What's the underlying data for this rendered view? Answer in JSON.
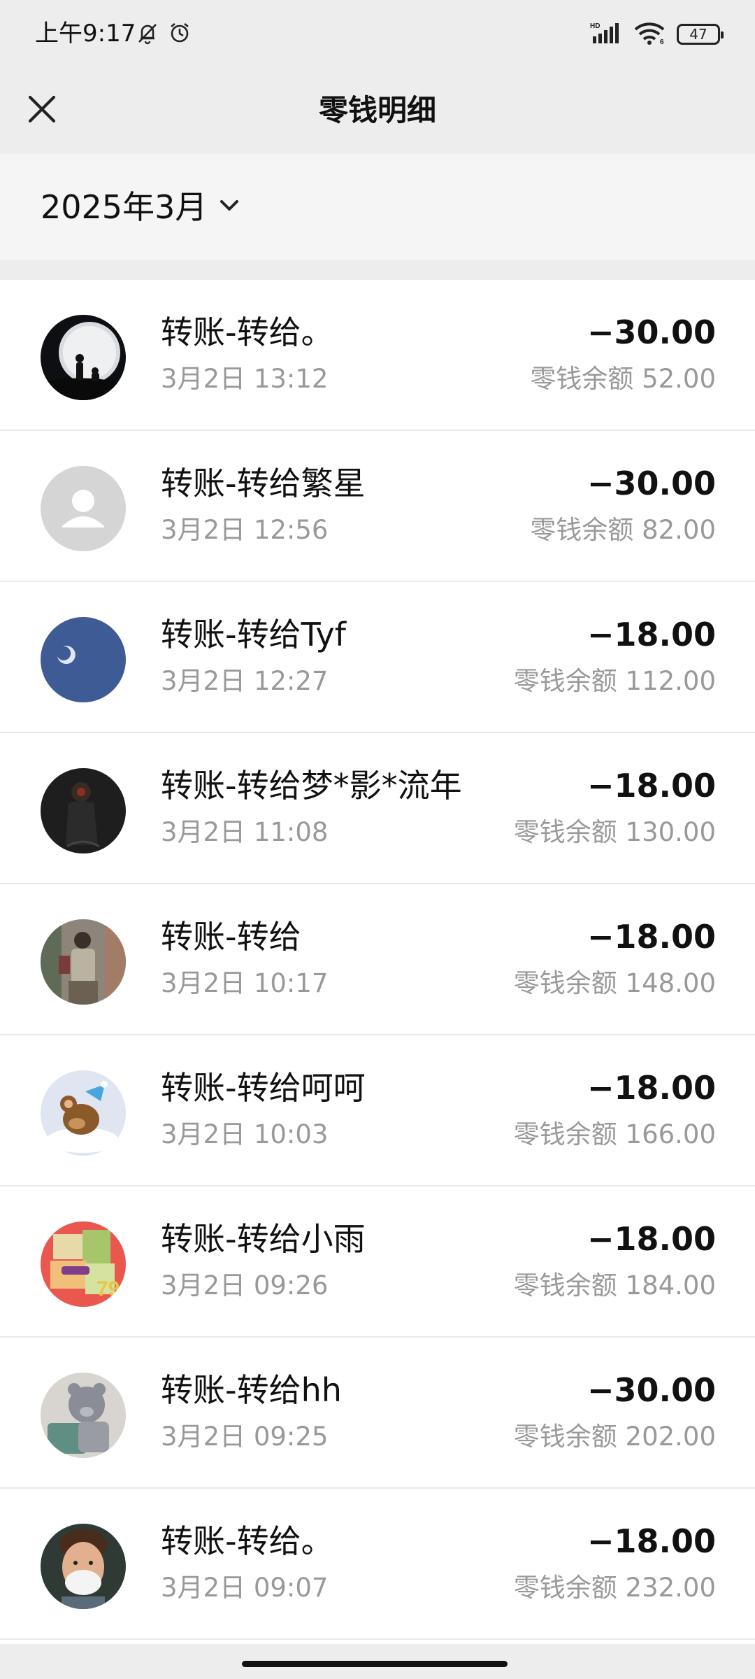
{
  "status": {
    "time": "上午9:17",
    "battery": "47",
    "network_badge": "HD",
    "wifi_badge": "6"
  },
  "header": {
    "title": "零钱明细",
    "close_icon": "close-icon"
  },
  "filter": {
    "month": "2025年3月",
    "dropdown_icon": "chevron-down-icon"
  },
  "transactions": [
    {
      "title": "转账-转给。",
      "time": "3月2日 13:12",
      "amount": "−30.00",
      "balance": "零钱余额 52.00",
      "avatar": "moon-silhouette"
    },
    {
      "title": "转账-转给繁星",
      "time": "3月2日 12:56",
      "amount": "−30.00",
      "balance": "零钱余额 82.00",
      "avatar": "default-user"
    },
    {
      "title": "转账-转给Tyf",
      "time": "3月2日 12:27",
      "amount": "−18.00",
      "balance": "零钱余额 112.00",
      "avatar": "night-sky"
    },
    {
      "title": "转账-转给梦*影*流年",
      "time": "3月2日 11:08",
      "amount": "−18.00",
      "balance": "零钱余额 130.00",
      "avatar": "dark-figure"
    },
    {
      "title": "转账-转给",
      "time": "3月2日 10:17",
      "amount": "−18.00",
      "balance": "零钱余额 148.00",
      "avatar": "mirror-selfie"
    },
    {
      "title": "转账-转给呵呵",
      "time": "3月2日 10:03",
      "amount": "−18.00",
      "balance": "零钱余额 166.00",
      "avatar": "cartoon-mouse"
    },
    {
      "title": "转账-转给小雨",
      "time": "3月2日 09:26",
      "amount": "−18.00",
      "balance": "零钱余额 184.00",
      "avatar": "colorful-map"
    },
    {
      "title": "转账-转给hh",
      "time": "3月2日 09:25",
      "amount": "−30.00",
      "balance": "零钱余额 202.00",
      "avatar": "gray-cat"
    },
    {
      "title": "转账-转给。",
      "time": "3月2日 09:07",
      "amount": "−18.00",
      "balance": "零钱余额 232.00",
      "avatar": "smiling-man"
    }
  ],
  "colors": {
    "header_bg": "#ededed",
    "filter_bg": "#f5f5f5",
    "list_bg": "#ffffff",
    "secondary_text": "#999999",
    "divider": "#e9e9e9"
  }
}
